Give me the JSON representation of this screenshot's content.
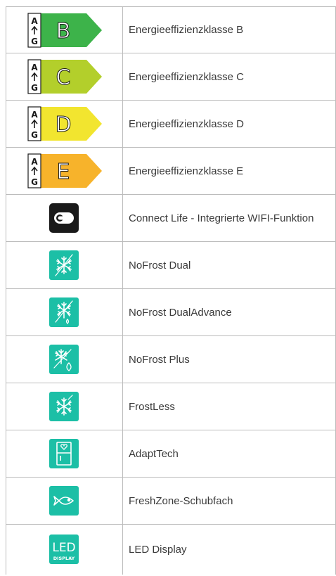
{
  "energy_rows": [
    {
      "scale_top": "A",
      "scale_bottom": "G",
      "letter": "B",
      "color": "#3db34a",
      "label": "Energieeffizienzklasse B"
    },
    {
      "scale_top": "A",
      "scale_bottom": "G",
      "letter": "C",
      "color": "#b3cf2b",
      "label": "Energieeffizienzklasse C"
    },
    {
      "scale_top": "A",
      "scale_bottom": "G",
      "letter": "D",
      "color": "#f2e52f",
      "label": "Energieeffizienzklasse D"
    },
    {
      "scale_top": "A",
      "scale_bottom": "G",
      "letter": "E",
      "color": "#f7b32b",
      "label": "Energieeffizienzklasse E"
    }
  ],
  "feature_rows": [
    {
      "icon": "connect-life-icon",
      "label": "Connect Life - Integrierte WIFI-Funktion"
    },
    {
      "icon": "nofrost-dual-icon",
      "label": "NoFrost Dual"
    },
    {
      "icon": "nofrost-dualadvance-icon",
      "label": "NoFrost DualAdvance"
    },
    {
      "icon": "nofrost-plus-icon",
      "label": "NoFrost Plus"
    },
    {
      "icon": "frostless-icon",
      "label": "FrostLess"
    },
    {
      "icon": "adapttech-icon",
      "label": "AdaptTech"
    },
    {
      "icon": "freshzone-icon",
      "label": "FreshZone-Schubfach"
    },
    {
      "icon": "led-display-icon",
      "label": "LED Display",
      "icon_text_top": "LED",
      "icon_text_bottom": "DISPLAY"
    }
  ],
  "colors": {
    "teal": "#1cbfa6",
    "dark": "#1a1a1a",
    "border": "#bcbcbc"
  }
}
